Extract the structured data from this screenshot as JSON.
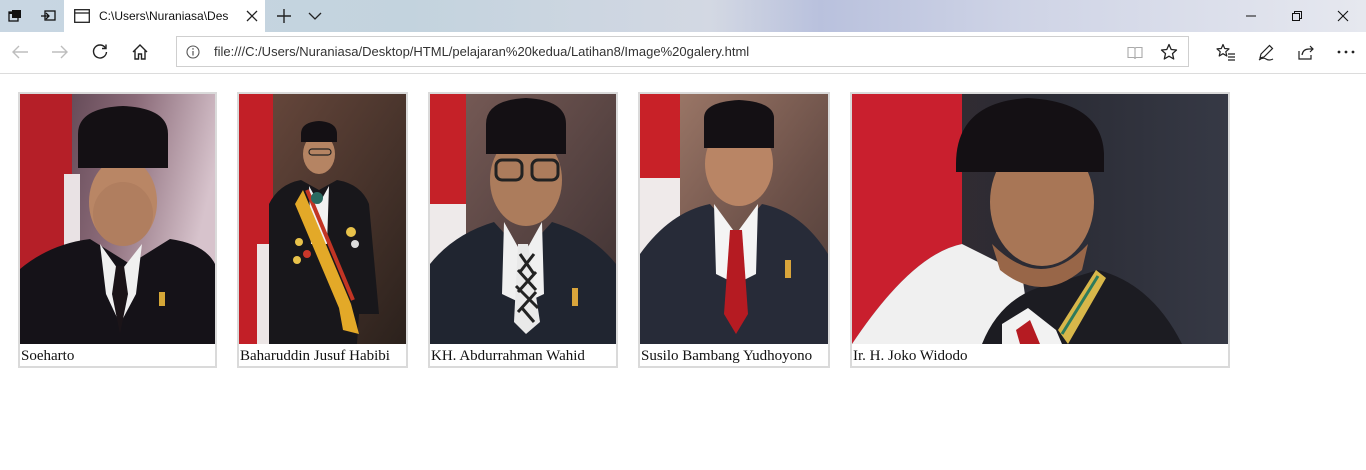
{
  "browser": {
    "tab_title": "C:\\Users\\Nuraniasa\\Des",
    "address_url": "file:///C:/Users/Nuraniasa/Desktop/HTML/pelajaran%20kedua/Latihan8/Image%20galery.html"
  },
  "icons": {
    "tab_actions": "tab-actions-icon",
    "set_aside": "set-aside-tabs-icon",
    "page": "page-icon",
    "close_tab": "close-icon",
    "new_tab": "plus-icon",
    "tab_list": "chevron-down-icon",
    "minimize": "minimize-icon",
    "restore": "restore-icon",
    "close_window": "close-icon",
    "back": "back-arrow-icon",
    "forward": "forward-arrow-icon",
    "refresh": "refresh-icon",
    "home": "home-icon",
    "info": "info-icon",
    "reading_view": "reading-view-icon",
    "favorite": "star-icon",
    "favorites_hub": "favorites-icon",
    "notes": "pen-icon",
    "share": "share-icon",
    "more": "more-icon"
  },
  "gallery": {
    "items": [
      {
        "caption": "Soeharto"
      },
      {
        "caption": "Baharuddin Jusuf Habibi"
      },
      {
        "caption": "KH. Abdurrahman Wahid"
      },
      {
        "caption": "Susilo Bambang Yudhoyono"
      },
      {
        "caption": "Ir. H. Joko Widodo"
      }
    ]
  },
  "colors": {
    "flag_red": "#c8202a",
    "flag_white": "#f2f2f2",
    "suit_dark": "#15161c",
    "tie_red": "#b01c22",
    "skin": "#b88664"
  }
}
